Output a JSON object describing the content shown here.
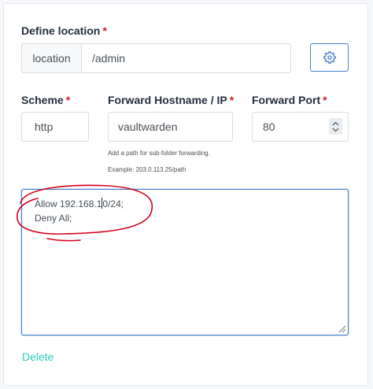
{
  "define_location": {
    "label": "Define location",
    "required_mark": "*",
    "prefix": "location",
    "value": "/admin"
  },
  "settings_button": {
    "icon": "gear-icon"
  },
  "scheme": {
    "label": "Scheme",
    "required_mark": "*",
    "value": "http"
  },
  "forward_hostname": {
    "label": "Forward Hostname / IP",
    "required_mark": "*",
    "value": "vaultwarden",
    "help_text": "Add a path for sub-folder forwarding.",
    "example": "Example: 203.0.113.25/path"
  },
  "forward_port": {
    "label": "Forward Port",
    "required_mark": "*",
    "value": "80"
  },
  "advanced_config": {
    "line1_before_caret": "Allow 192.168.1",
    "line1_after_caret": "0/24;",
    "line2": "Deny All;"
  },
  "delete_link": "Delete",
  "colors": {
    "primary": "#467fcf",
    "required": "#cd201f",
    "delete": "#2bcbba",
    "annotation": "#d6001c"
  }
}
